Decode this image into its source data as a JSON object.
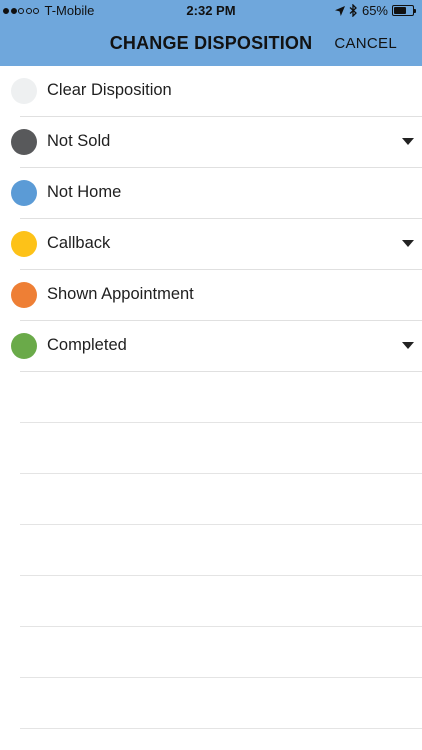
{
  "status_bar": {
    "carrier": "T-Mobile",
    "time": "2:32 PM",
    "battery": "65%",
    "battery_level": 0.65,
    "signal_bars_filled": 2,
    "signal_bars_total": 5
  },
  "header": {
    "title": "CHANGE DISPOSITION",
    "cancel_label": "CANCEL",
    "background_color": "#6fa7dc"
  },
  "dispositions": [
    {
      "label": "Clear Disposition",
      "color": "#eef0f1",
      "icon": "clear-circle-icon",
      "has_dropdown": false
    },
    {
      "label": "Not Sold",
      "color": "#58595b",
      "icon": "gray-circle-icon",
      "has_dropdown": true
    },
    {
      "label": "Not Home",
      "color": "#5b9bd6",
      "icon": "blue-circle-icon",
      "has_dropdown": false
    },
    {
      "label": "Callback",
      "color": "#fdc218",
      "icon": "yellow-circle-icon",
      "has_dropdown": true
    },
    {
      "label": "Shown Appointment",
      "color": "#ee7f35",
      "icon": "orange-circle-icon",
      "has_dropdown": false
    },
    {
      "label": "Completed",
      "color": "#6aaa49",
      "icon": "green-circle-icon",
      "has_dropdown": true
    }
  ],
  "empty_rows": 7
}
